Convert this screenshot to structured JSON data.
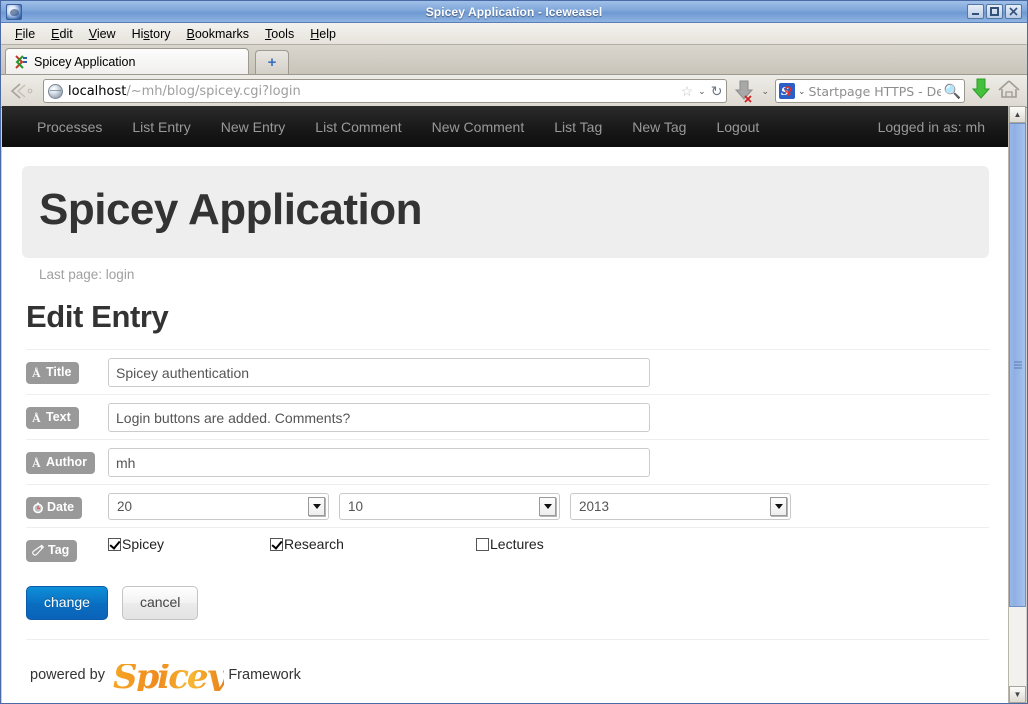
{
  "window": {
    "title": "Spicey Application - Iceweasel",
    "icon": "iceweasel-icon",
    "minimize_label": "–",
    "maximize_label": "□",
    "close_label": "✕"
  },
  "menubar": {
    "items": [
      {
        "label": "File",
        "accesskey": "F"
      },
      {
        "label": "Edit",
        "accesskey": "E"
      },
      {
        "label": "View",
        "accesskey": "V"
      },
      {
        "label": "History",
        "accesskey": "s"
      },
      {
        "label": "Bookmarks",
        "accesskey": "B"
      },
      {
        "label": "Tools",
        "accesskey": "T"
      },
      {
        "label": "Help",
        "accesskey": "H"
      }
    ]
  },
  "tabs": {
    "items": [
      {
        "label": "Spicey Application",
        "favicon": "iceweasel-favicon",
        "active": true
      }
    ],
    "new_tab_label": "+"
  },
  "toolbar": {
    "back_forward_icon": "back-forward-icon",
    "url_host": "localhost",
    "url_path": "/~mh/blog/spicey.cgi?login",
    "bookmark_star_icon": "star-icon",
    "bookmark_caret": "⌄",
    "reload_icon": "reload-icon",
    "download_icon": "download-arrow-icon",
    "download_caret": "⌄",
    "search_engine_icon": "startpage-icon",
    "search_engine_caret": "⌄",
    "search_placeholder": "Startpage HTTPS - De",
    "search_magnifier_icon": "magnifier-icon",
    "downloads_green_icon": "green-download-arrow-icon",
    "home_icon": "home-icon"
  },
  "scrollbar": {
    "up_label": "▲",
    "down_label": "▼"
  },
  "app": {
    "nav": {
      "links": [
        "Processes",
        "List Entry",
        "New Entry",
        "List Comment",
        "New Comment",
        "List Tag",
        "New Tag",
        "Logout"
      ],
      "user_status": "Logged in as: mh"
    },
    "hero_title": "Spicey Application",
    "last_page": "Last page: login",
    "page_title": "Edit Entry",
    "form": {
      "rows": [
        {
          "label": "Title",
          "icon": "font-text-icon",
          "type": "text",
          "value": "Spicey authentication"
        },
        {
          "label": "Text",
          "icon": "font-text-icon",
          "type": "text",
          "value": "Login buttons are added. Comments?"
        },
        {
          "label": "Author",
          "icon": "font-text-icon",
          "type": "text",
          "value": "mh"
        },
        {
          "label": "Date",
          "icon": "clock-icon",
          "type": "date",
          "selects": [
            {
              "name": "day",
              "value": "20"
            },
            {
              "name": "month",
              "value": "10"
            },
            {
              "name": "year",
              "value": "2013"
            }
          ]
        },
        {
          "label": "Tag",
          "icon": "tag-icon",
          "type": "checkboxes",
          "options": [
            {
              "label": "Spicey",
              "checked": true
            },
            {
              "label": "Research",
              "checked": true
            },
            {
              "label": "Lectures",
              "checked": false
            }
          ]
        }
      ]
    },
    "buttons": {
      "submit_label": "change",
      "cancel_label": "cancel"
    },
    "footer": {
      "prefix": "powered by",
      "logo_text": "Spicey",
      "suffix": "Framework"
    }
  },
  "colors": {
    "navbar_bg": "#1a1a1a",
    "navbar_text": "#999999",
    "hero_bg": "#eeeeee",
    "heading": "#333333",
    "badge_bg": "#999999",
    "primary_button": "#0a6ec0",
    "logo_orange": "#f0a030"
  }
}
